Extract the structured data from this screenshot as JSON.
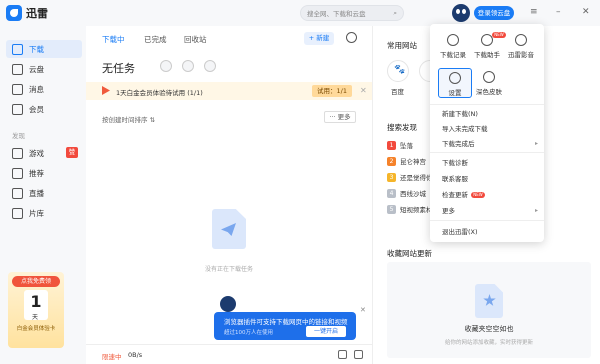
{
  "app": {
    "name": "迅雷"
  },
  "topbar": {
    "search_placeholder": "搜全网、下载和云盘",
    "login_button": "登录领云盘"
  },
  "sidebar": {
    "items": [
      {
        "label": "下载",
        "icon": "download-icon",
        "active": true
      },
      {
        "label": "云盘",
        "icon": "cloud-icon"
      },
      {
        "label": "消息",
        "icon": "message-icon"
      },
      {
        "label": "会员",
        "icon": "vip-icon"
      }
    ],
    "section_label": "发现",
    "discover_items": [
      {
        "label": "游戏",
        "icon": "game-icon",
        "badge": "赞"
      },
      {
        "label": "推荐",
        "icon": "recommend-icon"
      },
      {
        "label": "直播",
        "icon": "live-icon"
      },
      {
        "label": "片库",
        "icon": "library-icon"
      }
    ],
    "promo": {
      "tag": "点我免费领",
      "number": "1",
      "unit": "天",
      "footer": "白金会员体验卡"
    }
  },
  "main": {
    "tabs": [
      "下载中",
      "已完成",
      "回收站"
    ],
    "new_button": "+ 新建",
    "title": "无任务",
    "trial": {
      "text": "1天白金会员体验待试用 (1/1)",
      "pill": "试用：1/1"
    },
    "sort_label": "按创建时间排序 ⇅",
    "more_button": "··· 更多",
    "empty_text": "没有正在下载任务",
    "toast": {
      "title": "浏览器插件可支持下载网页中的链接和视频",
      "subtitle": "超过100万人在使用",
      "button": "一键开启"
    },
    "status": {
      "speed_label": "限速中",
      "speed_value": "0B/s"
    }
  },
  "right": {
    "common_sites_title": "常用网站",
    "sites": [
      {
        "label": "百度"
      },
      {
        "label": ""
      }
    ],
    "search_discover_title": "搜索发现",
    "hot": [
      {
        "num": "1",
        "label": "坠落",
        "color": "#f24a3d"
      },
      {
        "num": "2",
        "label": "昆仑神宫",
        "color": "#f5822a"
      },
      {
        "num": "3",
        "label": "还是觉得你最好",
        "color": "#f5b52a"
      },
      {
        "num": "4",
        "label": "西线沙城",
        "color": "#b9bfc8"
      },
      {
        "num": "5",
        "label": "短视频素材",
        "color": "#b9bfc8"
      }
    ],
    "fav_title": "收藏网站更新",
    "fav_empty_title": "收藏夹空空如也",
    "fav_empty_sub": "给你的网站添加收藏，实时获得更新"
  },
  "menu": {
    "top_items": [
      {
        "label": "下载记录",
        "icon": "history-icon"
      },
      {
        "label": "下载助手",
        "icon": "assistant-icon",
        "tag": "NEW"
      },
      {
        "label": "迅雷影音",
        "icon": "player-icon"
      },
      {
        "label": "设置",
        "icon": "settings-icon",
        "selected": true
      },
      {
        "label": "深色皮肤",
        "icon": "moon-icon"
      }
    ],
    "items": [
      {
        "label": "新建下载(N)"
      },
      {
        "label": "导入未完成下载"
      },
      {
        "label": "下载完成后",
        "arrow": true
      },
      {
        "label": "下载诊断"
      },
      {
        "label": "联系客服"
      },
      {
        "label": "检查更新",
        "tag": "NEW"
      },
      {
        "label": "更多",
        "arrow": true
      },
      {
        "label": "退出迅雷(X)"
      }
    ]
  },
  "colors": {
    "accent": "#1a7cf5",
    "danger": "#f24a3d"
  }
}
